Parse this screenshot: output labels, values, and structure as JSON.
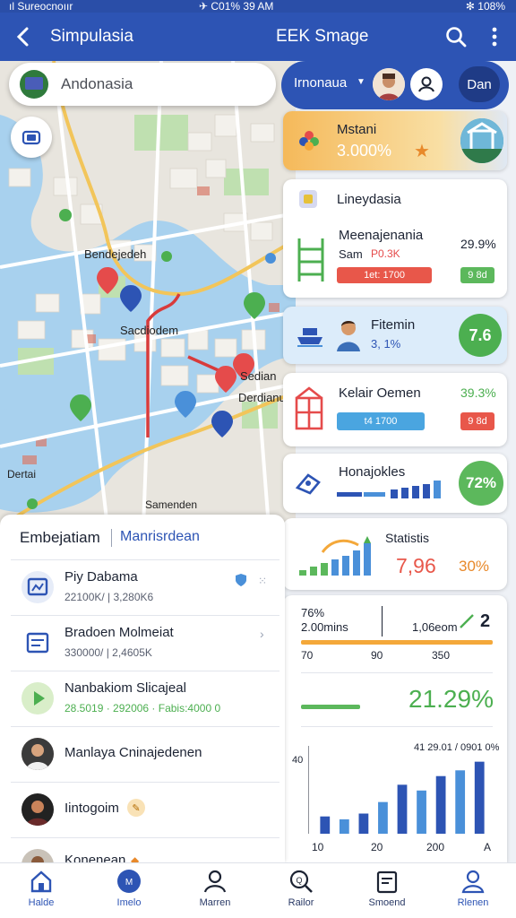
{
  "status_bar": {
    "left": "ıl Sureocnoıır",
    "center": "✈ C01% 39 AM",
    "right": "✻ 108%"
  },
  "app_bar": {
    "title": "Simpulasia",
    "center_title": "EEK Smage"
  },
  "search": {
    "value": "Andonasia"
  },
  "map": {
    "labels": [
      "Bendejedeh",
      "Sacdiodem",
      "Sedian",
      "Derdianu",
      "Dertai",
      "Samenden"
    ]
  },
  "account": {
    "name": "Irnonaua",
    "done_label": "Dan"
  },
  "cards": {
    "mstani": {
      "title": "Mstani",
      "value": "3.000%"
    },
    "lineydasia": {
      "header": "Lineydasia",
      "title": "Meenajenania",
      "sub": "Sam",
      "sub_value": "P0.3K",
      "pct": "29.9%",
      "chip_red": "1et: 1700",
      "chip_green": "9 8d"
    },
    "fitenim": {
      "title": "Fitemin",
      "sub": "3, 1%",
      "circle": "7.6"
    },
    "kelair": {
      "title": "Kelair Oemen",
      "pct": "39.3%",
      "chip_blue": "t4  1700",
      "chip_red": "9 8d"
    },
    "honajokles": {
      "title": "Honajokles",
      "circle": "72%"
    },
    "statistis": {
      "title": "Statistis",
      "value": "7,96",
      "pct": "30%"
    },
    "metrics": {
      "line1": "76%",
      "line2": "2.00mins",
      "mid": "1,06eom",
      "right": "2",
      "ticks": [
        "70",
        "90",
        "350"
      ],
      "big": "21.29%",
      "range": "41 29.01 / 0901 0%",
      "y_label": "40",
      "x_ticks": [
        "10",
        "20",
        "200",
        "A"
      ]
    }
  },
  "chart_data": {
    "type": "bar",
    "categories": [
      "",
      "",
      "",
      "",
      "",
      "",
      "",
      "",
      ""
    ],
    "values": [
      12,
      10,
      14,
      22,
      34,
      30,
      40,
      44,
      50
    ],
    "ylim": [
      0,
      56
    ]
  },
  "list": {
    "tab_a": "Embejatiam",
    "tab_b": "Manrisrdean",
    "rows": [
      {
        "name": "Piy Dabama",
        "sub": "22100K/  |  3,280K6"
      },
      {
        "name": "Bradoen Molmeiat",
        "sub": "330000/  |  2,4605K"
      },
      {
        "name": "Nanbakiom Slicajeal",
        "sub": "28.5019 · 292006 · Fabis:4000 0"
      },
      {
        "name": "Manlaya Cninajedenen",
        "sub": ""
      },
      {
        "name": "Iintogoim",
        "sub": ""
      },
      {
        "name": "Konenean",
        "sub": ""
      }
    ]
  },
  "nav": {
    "items": [
      {
        "label": "Halde"
      },
      {
        "label": "Imelo"
      },
      {
        "label": "Marren"
      },
      {
        "label": "Railor"
      },
      {
        "label": "Smoend"
      },
      {
        "label": "Rlenen"
      }
    ]
  },
  "colors": {
    "primary": "#2d54b4",
    "green": "#4caf50",
    "red": "#e54b4b",
    "orange": "#f4a83a"
  }
}
